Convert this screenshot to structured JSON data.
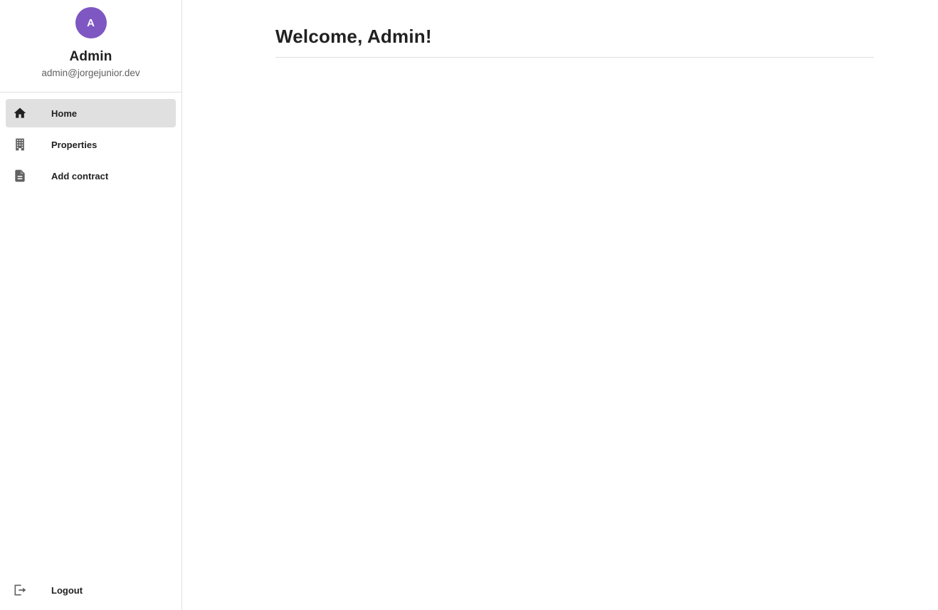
{
  "user": {
    "avatar_initial": "A",
    "avatar_color": "#7e57c2",
    "name": "Admin",
    "email": "admin@jorgejunior.dev"
  },
  "sidebar": {
    "items": [
      {
        "label": "Home",
        "icon": "home-icon",
        "active": true
      },
      {
        "label": "Properties",
        "icon": "building-icon",
        "active": false
      },
      {
        "label": "Add contract",
        "icon": "document-icon",
        "active": false
      }
    ],
    "logout": {
      "label": "Logout",
      "icon": "logout-icon"
    }
  },
  "main": {
    "title": "Welcome, Admin!"
  },
  "colors": {
    "active_item_bg": "#e0e0e0",
    "icon_dark": "#212121",
    "icon_gray": "#616161",
    "divider": "#e0e0e0"
  }
}
